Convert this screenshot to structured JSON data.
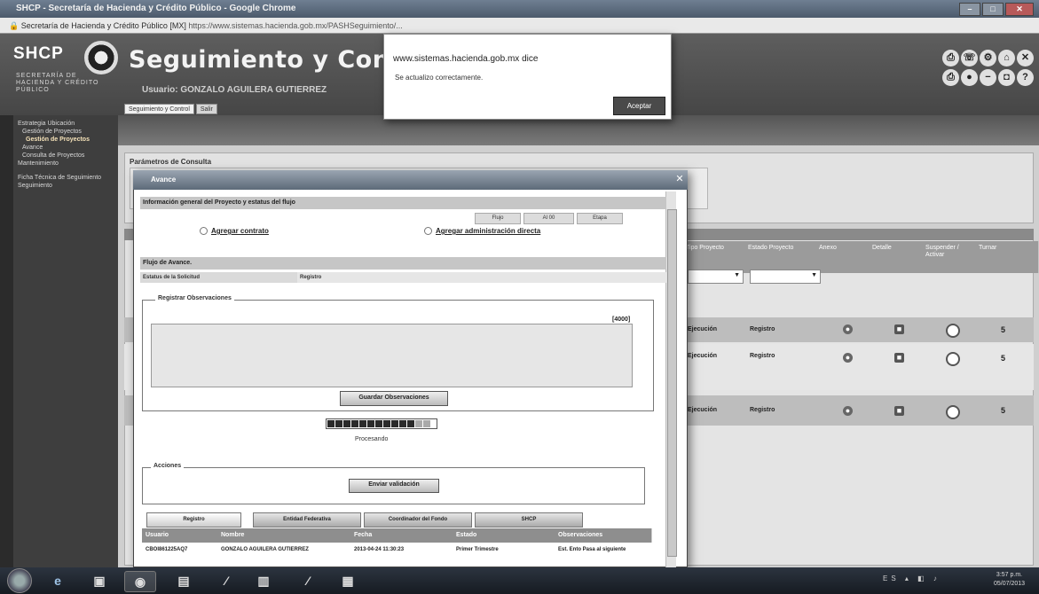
{
  "browser": {
    "title": "SHCP - Secretaría de Hacienda y Crédito Público - Google Chrome",
    "address_site": "Secretaría de Hacienda y Crédito Público [MX]",
    "address_url": "https://www.sistemas.hacienda.gob.mx/PASHSeguimiento/...",
    "minimize": "–",
    "maximize": "□",
    "close": "✕"
  },
  "header": {
    "logo": "SHCP",
    "logo_sub": "SECRETARÍA DE HACIENDA Y CRÉDITO PÚBLICO",
    "title": "Seguimiento y Control",
    "user": "Usuario: GONZALO AGUILERA GUTIERREZ",
    "tabs": [
      "Seguimiento y Control",
      "Salir"
    ],
    "tool_icons": [
      "printer-icon",
      "phone-icon",
      "gear-icon",
      "home-icon",
      "close-icon",
      "print-icon",
      "info-icon",
      "minus-icon",
      "window-icon",
      "help-icon"
    ],
    "tool_glyphs": [
      "⎙",
      "☏",
      "⚙",
      "⌂",
      "✕",
      "⎙",
      "●",
      "−",
      "◘",
      "?"
    ]
  },
  "alert": {
    "origin": "www.sistemas.hacienda.gob.mx dice",
    "message": "Se actualizo correctamente.",
    "ok": "Aceptar"
  },
  "sidebar": {
    "items": [
      "Estrategia Ubicación",
      "Gestión de Proyectos",
      "Gestión de Proyectos",
      "Avance",
      "Consulta de Proyectos",
      "Mantenimiento",
      "Ficha Técnica de Seguimiento",
      "Seguimiento"
    ]
  },
  "main": {
    "params_title": "Parámetros de Consulta",
    "grid": {
      "headers": [
        "Tipo Proyecto",
        "Estado Proyecto",
        "Anexo",
        "Detalle",
        "Suspender / Activar",
        "Turnar"
      ],
      "filter_arrow": "▼",
      "rows": [
        {
          "tipo": "Ejecución",
          "estado": "Registro",
          "turnar": "5"
        },
        {
          "tipo": "Ejecución",
          "estado": "Registro",
          "turnar": "5"
        },
        {
          "tipo": "Ejecución",
          "estado": "Registro",
          "turnar": "5"
        }
      ]
    }
  },
  "modal": {
    "title": "Avance",
    "close": "✕",
    "general_section": "Información general del Proyecto y estatus del flujo",
    "mini": [
      "Flujo",
      "Al 00",
      "Etapa"
    ],
    "radio_contrato": "Agregar contrato",
    "radio_admin": "Agregar administración directa",
    "flow_section": "Flujo de Avance.",
    "status_label": "Estatus de la Solicitud",
    "status_value": "Registro",
    "obs_legend": "Registrar Observaciones",
    "obs_counter": "[4000]",
    "obs_value": "",
    "save_button": "Guardar Observaciones",
    "progress": 0.85,
    "processing": "Procesando",
    "actions_legend": "Acciones",
    "send_button": "Enviar validación",
    "tabs": [
      "Registro",
      "Entidad Federativa",
      "Coordinador del Fondo",
      "SHCP"
    ],
    "table": {
      "headers": [
        "Usuario",
        "Nombre",
        "Fecha",
        "Estado",
        "Observaciones"
      ],
      "rows": [
        [
          "CBOI861225AQ7",
          "GONZALO AGUILERA GUTIERREZ",
          "2013-04-24 11:30:23",
          "Primer Trimestre",
          "Est. Ento Pasa al siguiente"
        ]
      ]
    }
  },
  "taskbar": {
    "ie": "e",
    "tray": "ES ▴ ◧ ♪",
    "time": "3:57 p.m.",
    "date": "05/07/2013"
  }
}
